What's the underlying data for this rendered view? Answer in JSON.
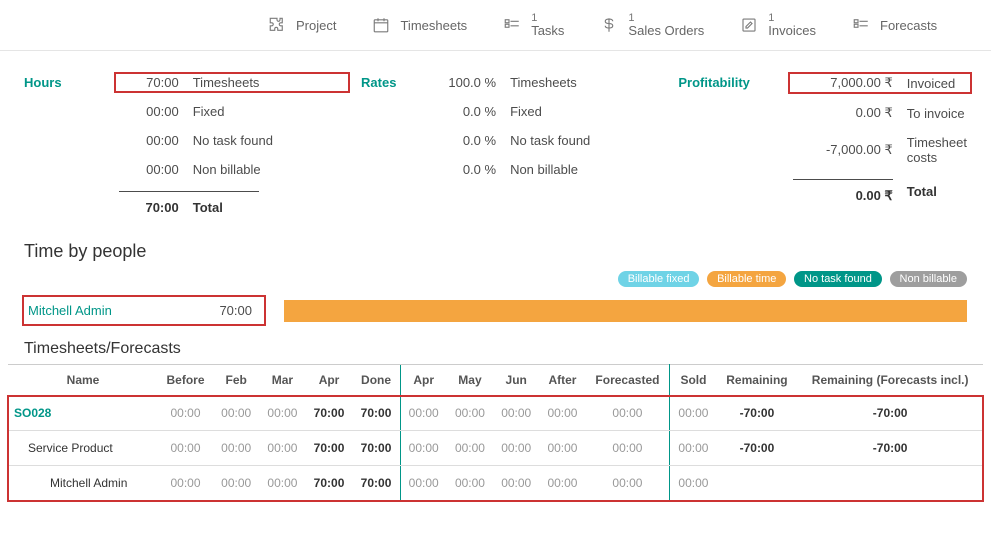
{
  "topnav": {
    "project": {
      "label": "Project"
    },
    "timesheets": {
      "label": "Timesheets"
    },
    "tasks": {
      "count": "1",
      "label": "Tasks"
    },
    "sales_orders": {
      "count": "1",
      "label": "Sales Orders"
    },
    "invoices": {
      "count": "1",
      "label": "Invoices"
    },
    "forecasts": {
      "label": "Forecasts"
    }
  },
  "summary": {
    "hours": {
      "heading": "Hours",
      "timesheets": {
        "value": "70:00",
        "label": "Timesheets"
      },
      "fixed": {
        "value": "00:00",
        "label": "Fixed"
      },
      "none": {
        "value": "00:00",
        "label": "No task found"
      },
      "nonbill": {
        "value": "00:00",
        "label": "Non billable"
      },
      "total": {
        "value": "70:00",
        "label": "Total"
      }
    },
    "rates": {
      "heading": "Rates",
      "timesheets": {
        "value": "100.0 %",
        "label": "Timesheets"
      },
      "fixed": {
        "value": "0.0 %",
        "label": "Fixed"
      },
      "none": {
        "value": "0.0 %",
        "label": "No task found"
      },
      "nonbill": {
        "value": "0.0 %",
        "label": "Non billable"
      }
    },
    "profitability": {
      "heading": "Profitability",
      "invoiced": {
        "value": "7,000.00 ₹",
        "label": "Invoiced"
      },
      "toinvoice": {
        "value": "0.00 ₹",
        "label": "To invoice"
      },
      "tscosts": {
        "value": "-7,000.00 ₹",
        "label": "Timesheet costs"
      },
      "total": {
        "value": "0.00 ₹",
        "label": "Total"
      }
    }
  },
  "time_by_people": {
    "heading": "Time by people",
    "legend": {
      "fixed": "Billable fixed",
      "time": "Billable time",
      "none": "No task found",
      "nonbill": "Non billable"
    },
    "rows": [
      {
        "name": "Mitchell Admin",
        "hours": "70:00"
      }
    ]
  },
  "ts_table": {
    "heading": "Timesheets/Forecasts",
    "headers": {
      "name": "Name",
      "before": "Before",
      "feb": "Feb",
      "mar": "Mar",
      "apr": "Apr",
      "done": "Done",
      "apr2": "Apr",
      "may": "May",
      "jun": "Jun",
      "after": "After",
      "forecasted": "Forecasted",
      "sold": "Sold",
      "remaining": "Remaining",
      "remaining_fc": "Remaining (Forecasts incl.)"
    },
    "rows": [
      {
        "name": "SO028",
        "link": true,
        "indent": 0,
        "before": "00:00",
        "feb": "00:00",
        "mar": "00:00",
        "apr": "70:00",
        "done": "70:00",
        "apr2": "00:00",
        "may": "00:00",
        "jun": "00:00",
        "after": "00:00",
        "forecasted": "00:00",
        "sold": "00:00",
        "remaining": "-70:00",
        "remaining_fc": "-70:00"
      },
      {
        "name": "Service Product",
        "link": false,
        "indent": 1,
        "before": "00:00",
        "feb": "00:00",
        "mar": "00:00",
        "apr": "70:00",
        "done": "70:00",
        "apr2": "00:00",
        "may": "00:00",
        "jun": "00:00",
        "after": "00:00",
        "forecasted": "00:00",
        "sold": "00:00",
        "remaining": "-70:00",
        "remaining_fc": "-70:00"
      },
      {
        "name": "Mitchell Admin",
        "link": false,
        "indent": 2,
        "before": "00:00",
        "feb": "00:00",
        "mar": "00:00",
        "apr": "70:00",
        "done": "70:00",
        "apr2": "00:00",
        "may": "00:00",
        "jun": "00:00",
        "after": "00:00",
        "forecasted": "00:00",
        "sold": "00:00",
        "remaining": "",
        "remaining_fc": ""
      }
    ]
  }
}
